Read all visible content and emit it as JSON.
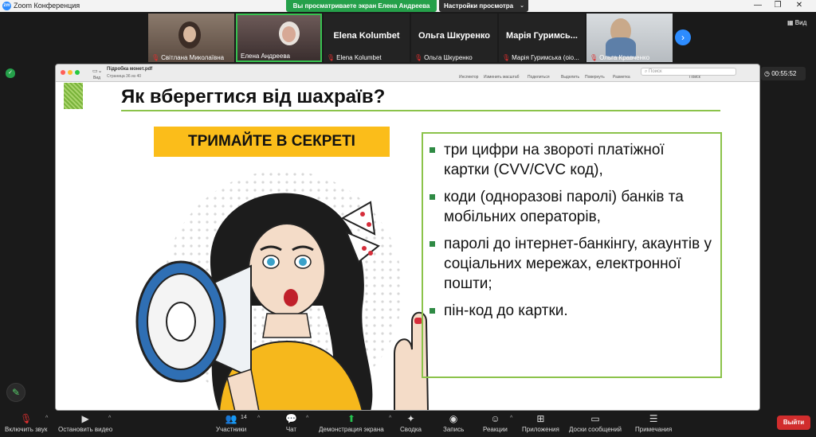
{
  "window": {
    "title": "Zoom Конференция",
    "app_icon": "zoom-icon",
    "share_banner": "Вы просматриваете экран Елена Андреева",
    "view_settings": "Настройки просмотра"
  },
  "participants_strip": [
    {
      "name": "Світлана Миколаївна",
      "video": true,
      "muted": true
    },
    {
      "name": "Елена Андреева",
      "video": true,
      "muted": false,
      "active_speaker": true
    },
    {
      "name": "Elena Kolumbet",
      "display": "Elena Kolumbet",
      "video": false,
      "muted": true
    },
    {
      "name": "Ольга Шкуренко",
      "display": "Ольга Шкуренко",
      "video": false,
      "muted": true
    },
    {
      "name": "Марія Гуримська (оіо...",
      "display": "Марія Гуримсь...",
      "video": false,
      "muted": true
    },
    {
      "name": "Ольга Кравченко",
      "video": true,
      "muted": true
    }
  ],
  "view_label": "Вид",
  "timer": "00:55:52",
  "viewer": {
    "file_name": "Підробка монет.pdf",
    "page_info": "Страница 36 из 40",
    "view_label": "Вид",
    "tools": [
      "Инспектор",
      "Изменить масштаб",
      "Поделиться",
      "Выделить",
      "Повернуть",
      "Разметка",
      "Поиск"
    ],
    "search_placeholder": "Поиск"
  },
  "slide": {
    "title": "Як вберегтися від шахраїв?",
    "banner": "ТРИМАЙТЕ В СЕКРЕТІ",
    "bullets": [
      "три цифри на звороті платіжної картки (CVV/CVC код),",
      "коди (одноразові паролі) банків та мобільних операторів,",
      "паролі до інтернет-банкінгу, акаунтів у соціальних мережах, електронної пошти;",
      "пін-код до картки."
    ],
    "accent_green": "#8bc34a",
    "banner_yellow": "#fbbd1a"
  },
  "bottom_toolbar": {
    "unmute": "Включить звук",
    "video": "Остановить видео",
    "participants": "Участники",
    "participants_count": "14",
    "chat": "Чат",
    "share": "Демонстрация экрана",
    "summary": "Сводка",
    "record": "Запись",
    "reactions": "Реакции",
    "apps": "Приложения",
    "whiteboards": "Доски сообщений",
    "notes": "Примечания",
    "leave": "Выйти"
  }
}
